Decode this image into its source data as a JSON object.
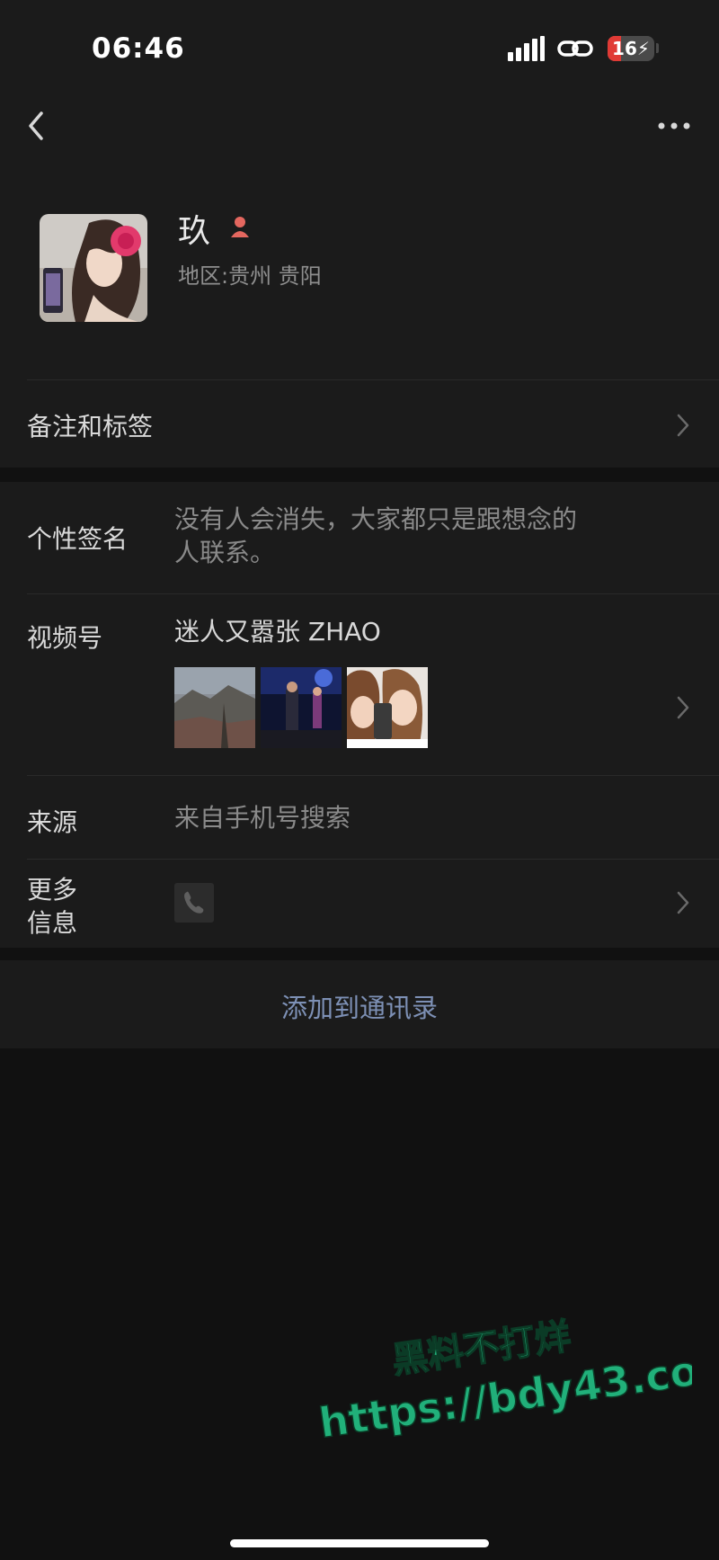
{
  "status_bar": {
    "time": "06:46",
    "battery": "16",
    "battery_level": 0.16,
    "battery_color": "#e03a35"
  },
  "nav": {
    "back_icon": "chevron-left-icon",
    "more_icon": "more-icon"
  },
  "profile": {
    "name": "玖",
    "gender_icon": "female-icon",
    "region_label": "地区:",
    "region_value": "贵州 贵阳"
  },
  "rows": {
    "remark": {
      "label": "备注和标签"
    },
    "signature": {
      "label": "个性签名",
      "line1": "没有人会消失，大家都只是跟想念的",
      "line2": "人联系。"
    },
    "channels": {
      "label": "视频号",
      "value": "迷人又嚣张 ZHAO",
      "thumbnails": [
        "landscape",
        "stage",
        "selfie"
      ]
    },
    "source": {
      "label": "来源",
      "value": "来自手机号搜索"
    },
    "more_info": {
      "label_line1": "更多",
      "label_line2": "信息",
      "icon": "phone-icon"
    }
  },
  "actions": {
    "add_contact": "添加到通讯录"
  },
  "watermark": {
    "line1": "黑料不打烊",
    "line2": "https://bdy43.co",
    "color": "#21b07a"
  },
  "colors": {
    "background": "#111111",
    "surface": "#1b1b1b",
    "link": "#7d90b5"
  }
}
